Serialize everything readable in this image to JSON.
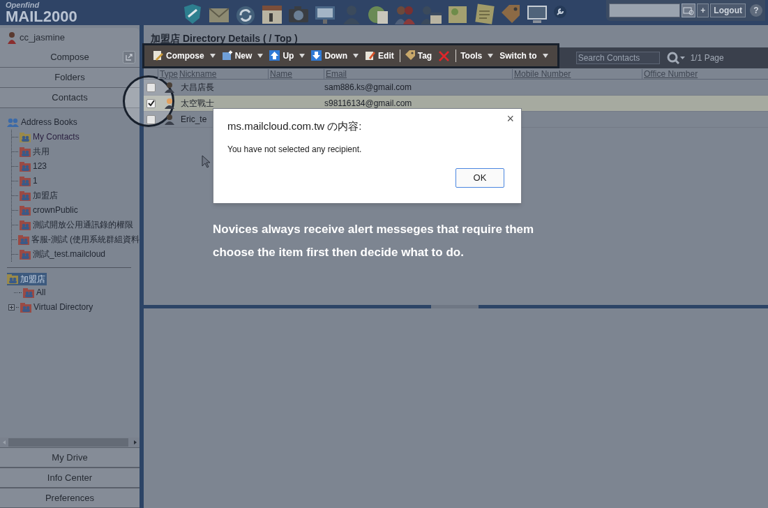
{
  "header": {
    "brand_small": "Openfind",
    "brand": "MAIL2000",
    "buttons": [
      "+",
      "Logout",
      "?"
    ]
  },
  "user": {
    "name": "cc_jasmine"
  },
  "sidebar": {
    "top_buttons": [
      {
        "label": "Compose",
        "popout": true
      },
      {
        "label": "Folders",
        "popout": false
      },
      {
        "label": "Contacts",
        "popout": false
      }
    ],
    "address_books": {
      "label": "Address Books",
      "children": [
        {
          "label": "My Contacts",
          "kind": "personal"
        },
        {
          "label": "共用",
          "kind": "shared"
        },
        {
          "label": "123",
          "kind": "shared"
        },
        {
          "label": "1",
          "kind": "shared"
        },
        {
          "label": "加盟店",
          "kind": "shared"
        },
        {
          "label": "crownPublic",
          "kind": "shared"
        },
        {
          "label": "測試開放公用通訊錄的權限",
          "kind": "shared"
        },
        {
          "label": "客服-測試 (使用系統群組資料",
          "kind": "shared"
        },
        {
          "label": "測試_test.mailcloud",
          "kind": "shared"
        }
      ]
    },
    "directory": {
      "label": "加盟店",
      "selected": true,
      "children": [
        {
          "label": "All",
          "expandable": false
        },
        {
          "label": "Virtual Directory",
          "expandable": true
        }
      ]
    },
    "bottom_buttons": [
      "My Drive",
      "Info Center",
      "Preferences"
    ]
  },
  "main": {
    "title": "加盟店 Directory Details ( / Top )",
    "toolbar": [
      {
        "label": "Compose",
        "dropdown": true,
        "separator_before": false
      },
      {
        "label": "New",
        "dropdown": true,
        "separator_before": false
      },
      {
        "label": "Up",
        "dropdown": true,
        "separator_before": false
      },
      {
        "label": "Down",
        "dropdown": true,
        "separator_before": false
      },
      {
        "label": "Edit",
        "dropdown": false,
        "separator_before": false
      },
      {
        "label": "Tag",
        "dropdown": false,
        "separator_before": true
      },
      {
        "dropdown": false,
        "separator_before": false
      },
      {
        "label": "Tools",
        "dropdown": true,
        "separator_before": true
      },
      {
        "label": "Switch to",
        "dropdown": true,
        "separator_before": false
      }
    ],
    "search_placeholder": "Search Contacts",
    "pager": "1/1 Page",
    "columns": [
      "Type",
      "Nickname",
      "Name",
      "Email",
      "Mobile Number",
      "Office Number"
    ],
    "rows": [
      {
        "checked": false,
        "selected": false,
        "nickname": "大昌店長",
        "email": "sam886.ks@gmail.com"
      },
      {
        "checked": true,
        "selected": true,
        "nickname": "太空戰士",
        "email": "s98116134@gmail.com"
      },
      {
        "checked": false,
        "selected": false,
        "nickname": "Eric_te"
      }
    ]
  },
  "dialog": {
    "title": "ms.mailcloud.com.tw の内容:",
    "message": "You have not selected any recipient.",
    "close": "×",
    "button": "OK"
  },
  "annotation": [
    "Novices always receive alert messeges that require them",
    "choose the item first then decide what to do."
  ]
}
